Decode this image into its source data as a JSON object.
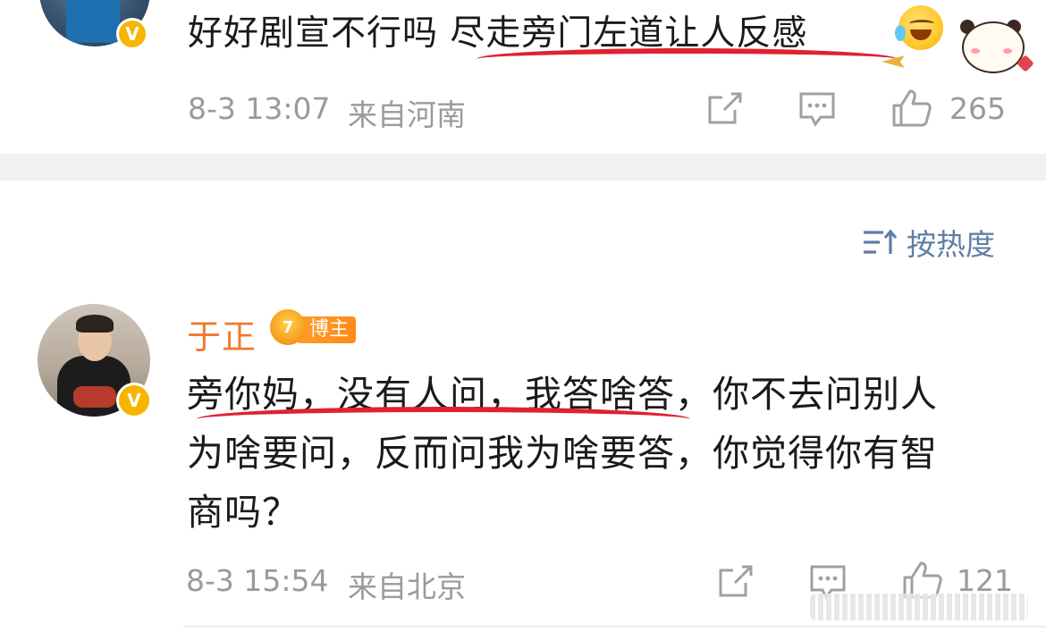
{
  "top_comment": {
    "text": "好好剧宣不行吗 尽走旁门左道让人反感",
    "emoji": "laughing-crying-emoji",
    "time": "8-3 13:07",
    "location": "来自河南",
    "likes": "265"
  },
  "sort": {
    "label": "按热度",
    "icon": "sort-icon"
  },
  "main_comment": {
    "username": "于正",
    "badge_level": "7",
    "badge_label": "博主",
    "lines": [
      "旁你妈，没有人问，我答啥答，你不去问别人",
      "为啥要问，反而问我为啥要答，你觉得你有智",
      "商吗？"
    ],
    "time": "8-3 15:54",
    "location": "来自北京",
    "likes": "121"
  },
  "colors": {
    "username": "#ef7a2c",
    "meta_text": "#9a9a9a",
    "sort_text": "#5e7fa4",
    "highlight_underline": "#e02230",
    "verified_badge": "#f7b500"
  }
}
